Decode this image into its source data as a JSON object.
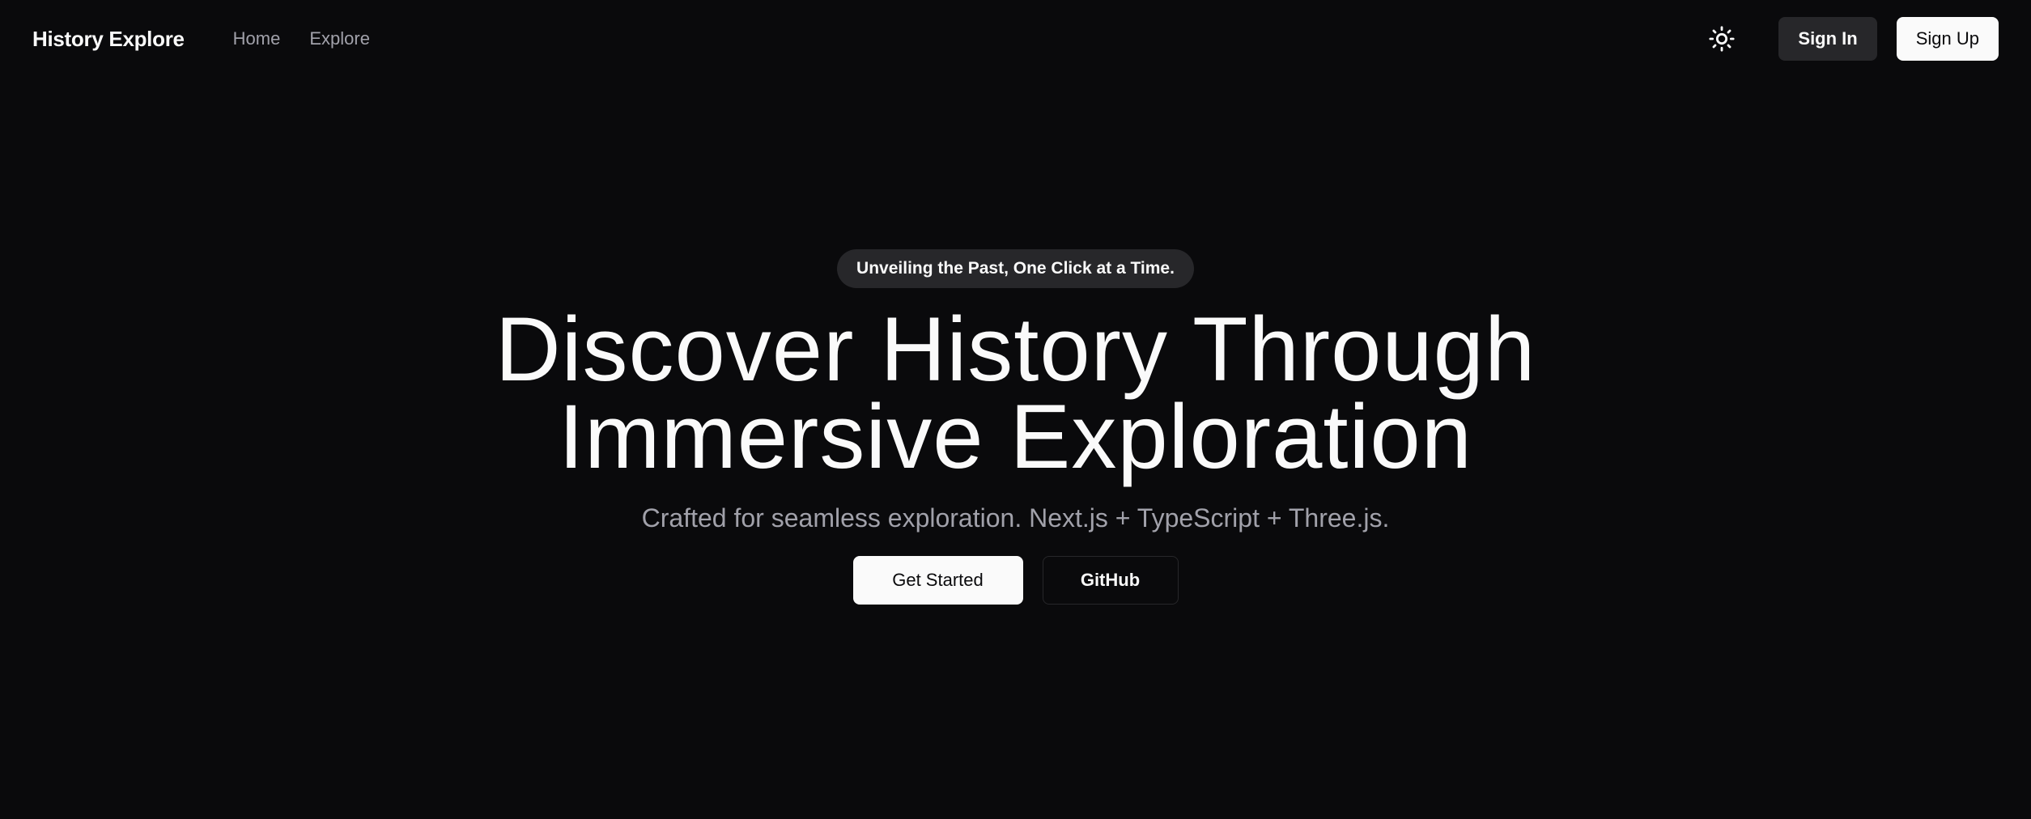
{
  "colors": {
    "background": "#0a0a0c",
    "foreground": "#fafafa",
    "muted": "#a1a1aa",
    "secondary": "#27272a"
  },
  "header": {
    "brand": "History Explore",
    "nav_links": [
      {
        "label": "Home"
      },
      {
        "label": "Explore"
      }
    ],
    "theme_toggle_icon": "sun-icon",
    "sign_in_label": "Sign In",
    "sign_up_label": "Sign Up"
  },
  "hero": {
    "tagline": "Unveiling the Past, One Click at a Time.",
    "headline_line1": "Discover History Through",
    "headline_line2": "Immersive Exploration",
    "subtitle": "Crafted for seamless exploration. Next.js + TypeScript + Three.js.",
    "primary_cta": "Get Started",
    "secondary_cta": "GitHub"
  }
}
